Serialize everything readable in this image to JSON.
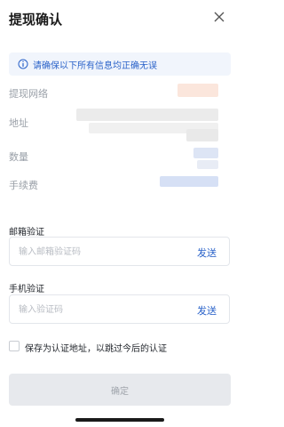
{
  "header": {
    "title": "提现确认",
    "close_icon": "close-icon"
  },
  "notice": {
    "icon": "info-icon",
    "text": "请确保以下所有信息均正确无误"
  },
  "details": {
    "network_label": "提现网络",
    "address_label": "地址",
    "amount_label": "数量",
    "fee_label": "手续费"
  },
  "email_verification": {
    "label": "邮箱验证",
    "placeholder": "输入邮箱验证码",
    "send_label": "发送"
  },
  "phone_verification": {
    "label": "手机验证",
    "placeholder": "输入验证码",
    "send_label": "发送"
  },
  "save_option": {
    "label": "保存为认证地址，以跳过今后的认证"
  },
  "confirm": {
    "label": "确定"
  },
  "colors": {
    "accent": "#2a62c9",
    "notice_bg": "#f1f5fc",
    "disabled_button": "#e7e9ed"
  }
}
